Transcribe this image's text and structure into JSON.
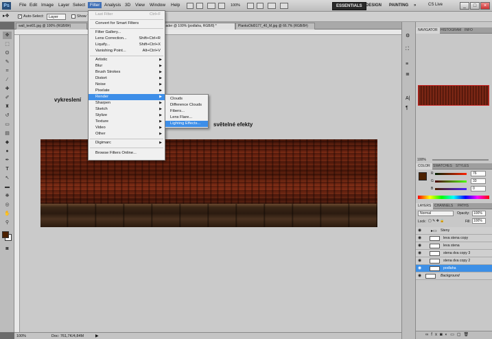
{
  "app_logo": "Ps",
  "menubar": {
    "items": [
      "File",
      "Edit",
      "Image",
      "Layer",
      "Select",
      "Filter",
      "Analysis",
      "3D",
      "View",
      "Window",
      "Help"
    ],
    "zoom": "100%",
    "workspaces": [
      "ESSENTIALS",
      "DESIGN",
      "PAINTING",
      "»"
    ],
    "cs_live": "CS Live"
  },
  "options": {
    "auto_select_label": "Auto-Select:",
    "auto_select_value": "Layer",
    "show_label": "Show T"
  },
  "tabs": [
    {
      "label": "wall_text01.jpg @ 100% (RGB/8#)"
    },
    {
      "label": "reader @ 100% (podlaha, RGB/8) *"
    },
    {
      "label": "PlanksOld0177_40_M.jpg @ 66.7% (RGB/8#)"
    }
  ],
  "canvas": {
    "label_vykresleni": "vykreslení",
    "label_efekty": "světelné efekty"
  },
  "filter_menu": {
    "items": [
      {
        "label": "Last Filter",
        "shortcut": "Ctrl+F",
        "disabled": true
      },
      {
        "label": "Convert for Smart Filters"
      },
      {
        "label": "Filter Gallery..."
      },
      {
        "label": "Lens Correction...",
        "shortcut": "Shift+Ctrl+R"
      },
      {
        "label": "Liquify...",
        "shortcut": "Shift+Ctrl+X"
      },
      {
        "label": "Vanishing Point...",
        "shortcut": "Alt+Ctrl+V"
      },
      {
        "label": "Artistic",
        "submenu": true
      },
      {
        "label": "Blur",
        "submenu": true
      },
      {
        "label": "Brush Strokes",
        "submenu": true
      },
      {
        "label": "Distort",
        "submenu": true
      },
      {
        "label": "Noise",
        "submenu": true
      },
      {
        "label": "Pixelate",
        "submenu": true
      },
      {
        "label": "Render",
        "submenu": true,
        "highlighted": true
      },
      {
        "label": "Sharpen",
        "submenu": true
      },
      {
        "label": "Sketch",
        "submenu": true
      },
      {
        "label": "Stylize",
        "submenu": true
      },
      {
        "label": "Texture",
        "submenu": true
      },
      {
        "label": "Video",
        "submenu": true
      },
      {
        "label": "Other",
        "submenu": true
      },
      {
        "label": "Digimarc",
        "submenu": true
      },
      {
        "label": "Browse Filters Online..."
      }
    ]
  },
  "render_submenu": {
    "items": [
      {
        "label": "Clouds"
      },
      {
        "label": "Difference Clouds"
      },
      {
        "label": "Fibers..."
      },
      {
        "label": "Lens Flare..."
      },
      {
        "label": "Lighting Effects...",
        "highlighted": true
      }
    ]
  },
  "status": {
    "zoom": "100%",
    "doc": "Doc: 761,7K/4,84M"
  },
  "navigator": {
    "tabs": [
      "NAVIGATOR",
      "HISTOGRAM",
      "INFO"
    ],
    "zoom": "100%"
  },
  "color_panel": {
    "tabs": [
      "COLOR",
      "SWATCHES",
      "STYLES"
    ],
    "channels": [
      {
        "name": "R",
        "value": "76"
      },
      {
        "name": "G",
        "value": "33"
      },
      {
        "name": "B",
        "value": "0"
      }
    ],
    "foreground": "#4c2100"
  },
  "layers_panel": {
    "tabs": [
      "LAYERS",
      "CHANNELS",
      "PATHS"
    ],
    "blend_mode": "Normal",
    "opacity_label": "Opacity:",
    "opacity": "100%",
    "lock_label": "Lock:",
    "fill_label": "Fill:",
    "fill": "100%",
    "layers": [
      {
        "name": "Steny",
        "group": true
      },
      {
        "name": "leva stena copy"
      },
      {
        "name": "leva stena"
      },
      {
        "name": "stena dva copy 3"
      },
      {
        "name": "stena dva copy 2"
      },
      {
        "name": "podlaha",
        "selected": true
      },
      {
        "name": "Background",
        "italic": true
      }
    ]
  }
}
